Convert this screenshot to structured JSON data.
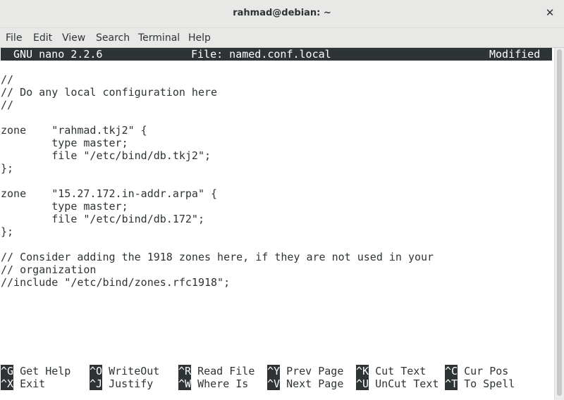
{
  "window": {
    "title": "rahmad@debian: ~",
    "close_symbol": "✕"
  },
  "menu": [
    "File",
    "Edit",
    "View",
    "Search",
    "Terminal",
    "Help"
  ],
  "nano": {
    "version": "GNU nano 2.2.6",
    "file": "File: named.conf.local",
    "status": "Modified"
  },
  "lines": [
    "",
    "//",
    "// Do any local configuration here",
    "//",
    "",
    "zone    \"rahmad.tkj2\" {",
    "        type master;",
    "        file \"/etc/bind/db.tkj2\";",
    "};",
    "",
    "zone    \"15.27.172.in-addr.arpa\" {",
    "        type master;",
    "        file \"/etc/bind/db.172\";",
    "};",
    "",
    "// Consider adding the 1918 zones here, if they are not used in your",
    "// organization",
    "//include \"/etc/bind/zones.rfc1918\";"
  ],
  "shortcuts": [
    [
      {
        "key": "^G",
        "label": "Get Help"
      },
      {
        "key": "^X",
        "label": "Exit"
      }
    ],
    [
      {
        "key": "^O",
        "label": "WriteOut"
      },
      {
        "key": "^J",
        "label": "Justify"
      }
    ],
    [
      {
        "key": "^R",
        "label": "Read File"
      },
      {
        "key": "^W",
        "label": "Where Is"
      }
    ],
    [
      {
        "key": "^Y",
        "label": "Prev Page"
      },
      {
        "key": "^V",
        "label": "Next Page"
      }
    ],
    [
      {
        "key": "^K",
        "label": "Cut Text"
      },
      {
        "key": "^U",
        "label": "UnCut Text"
      }
    ],
    [
      {
        "key": "^C",
        "label": "Cur Pos"
      },
      {
        "key": "^T",
        "label": "To Spell"
      }
    ]
  ]
}
